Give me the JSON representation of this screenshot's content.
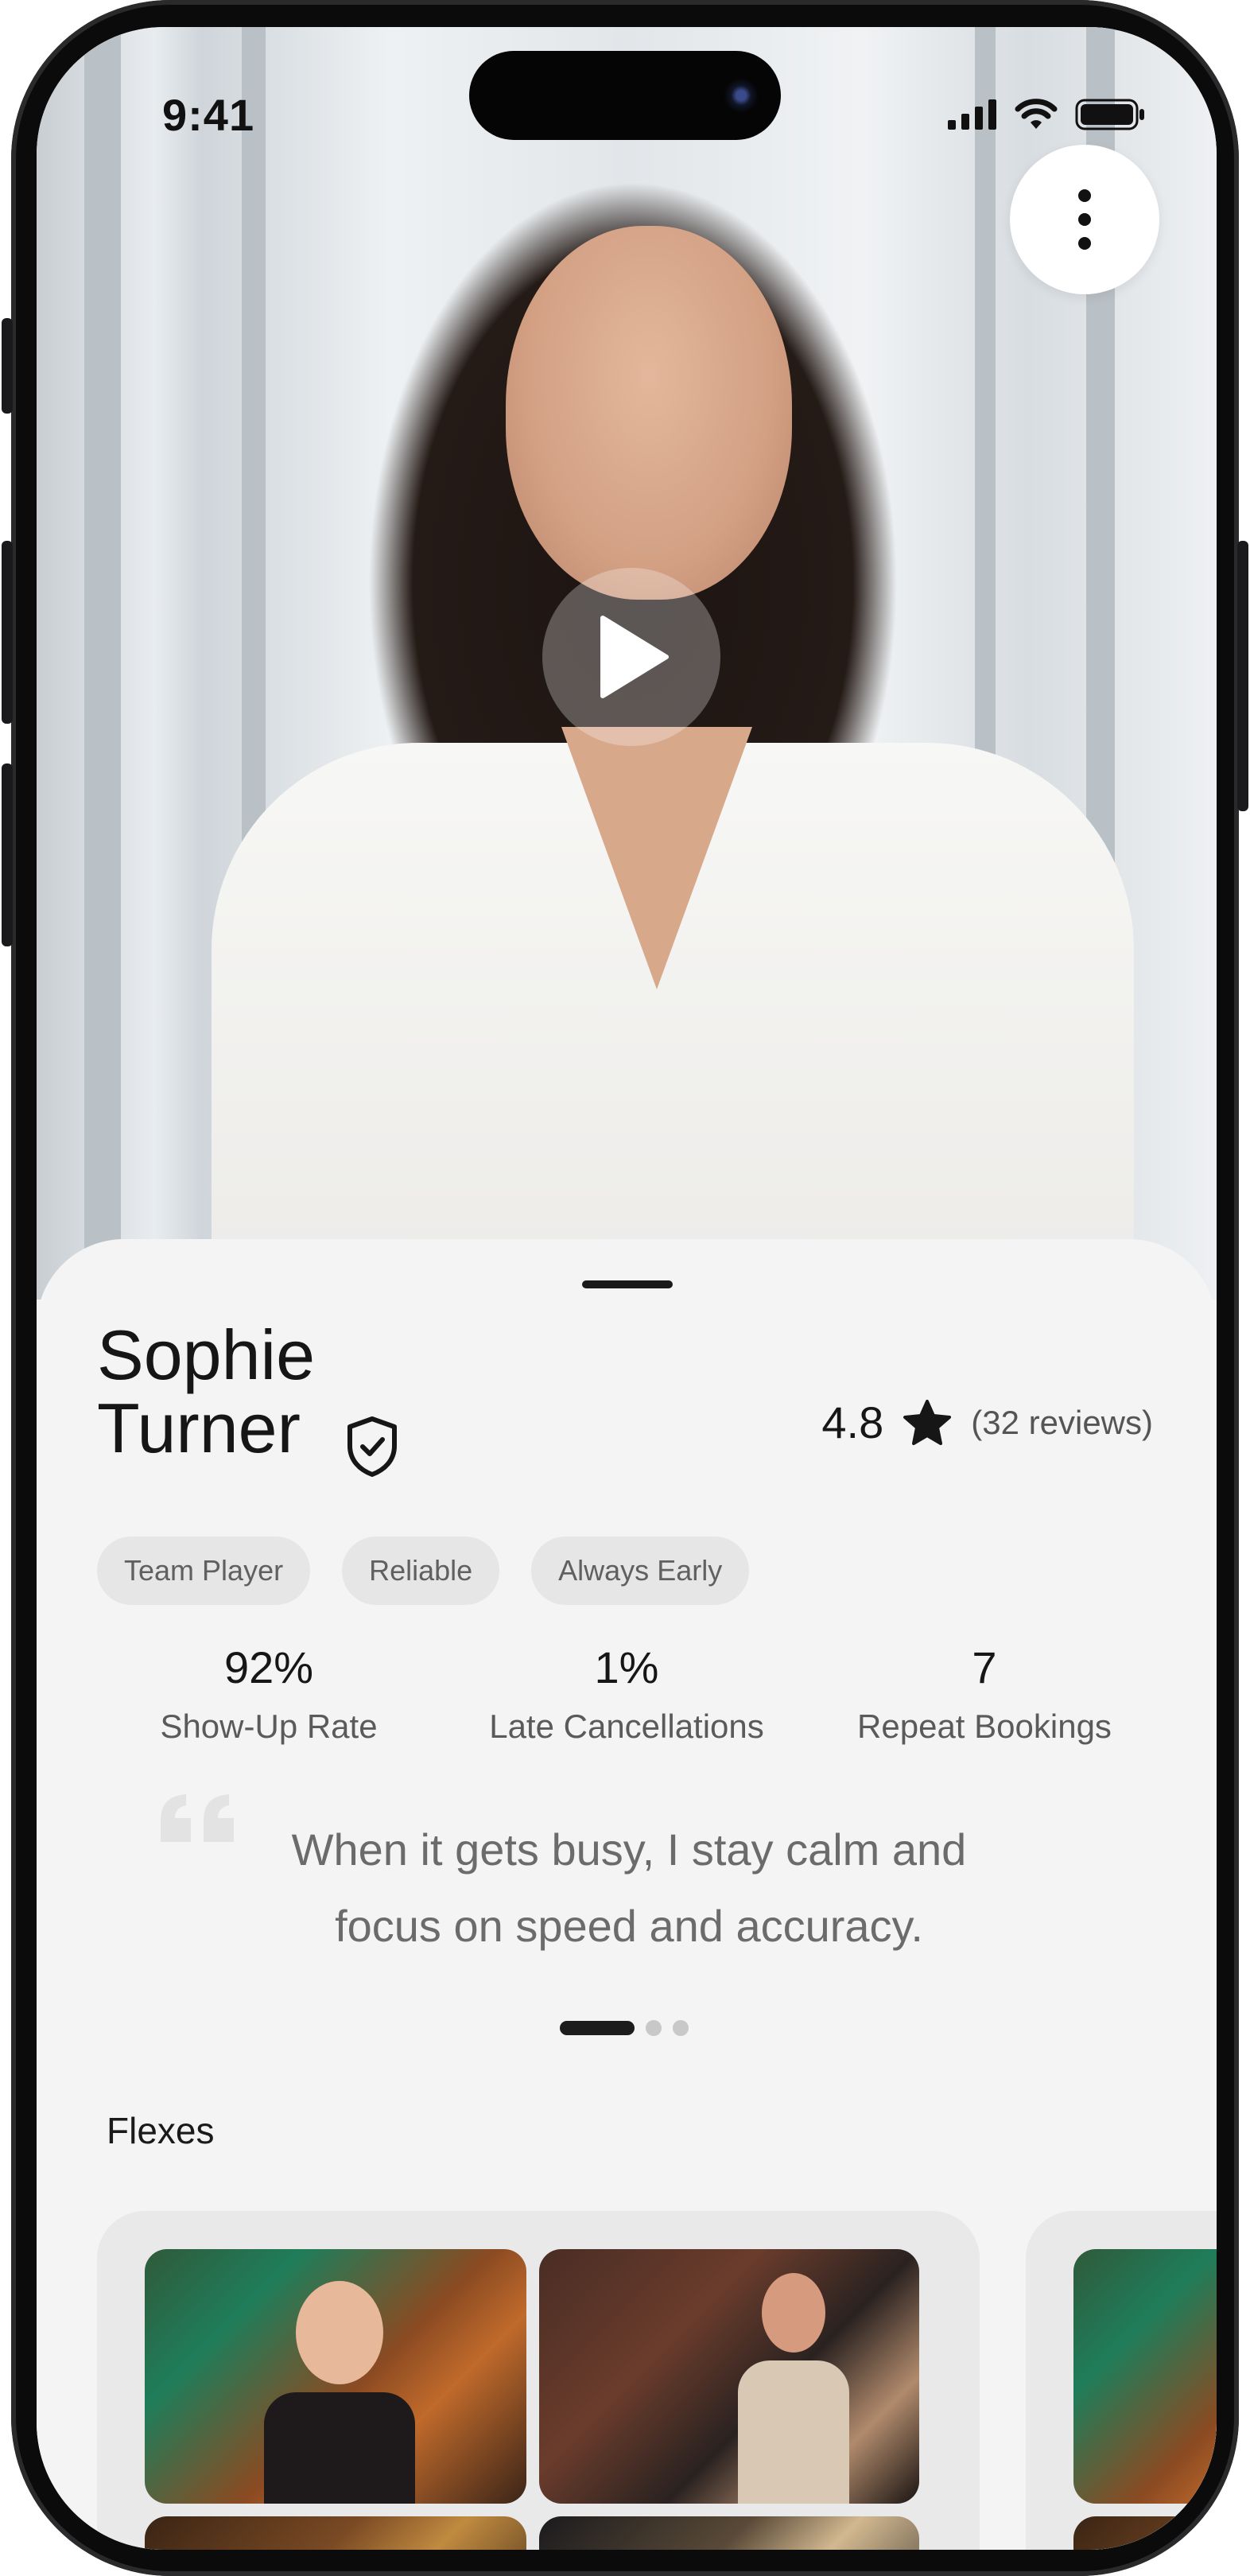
{
  "status_bar": {
    "time": "9:41"
  },
  "profile": {
    "name_first": "Sophie",
    "name_last": "Turner",
    "rating": "4.8",
    "reviews": "(32 reviews)",
    "tags": [
      "Team Player",
      "Reliable",
      "Always Early"
    ]
  },
  "stats": [
    {
      "value": "92%",
      "label": "Show-Up Rate"
    },
    {
      "value": "1%",
      "label": "Late Cancellations"
    },
    {
      "value": "7",
      "label": "Repeat Bookings"
    }
  ],
  "quote": {
    "line1": "When it gets busy, I stay calm and",
    "line2": "focus on speed and accuracy.",
    "pager_total": 3,
    "pager_active": 1
  },
  "flexes": {
    "title": "Flexes"
  },
  "icons": {
    "menu": "more-vertical-icon",
    "play": "play-icon",
    "verified": "shield-check-icon",
    "rating": "star-icon",
    "quote": "quote-icon"
  },
  "colors": {
    "text": "#161616",
    "muted": "#6b6b6b",
    "chip_bg": "#e6e6e6",
    "sheet_bg": "#f4f4f4"
  }
}
